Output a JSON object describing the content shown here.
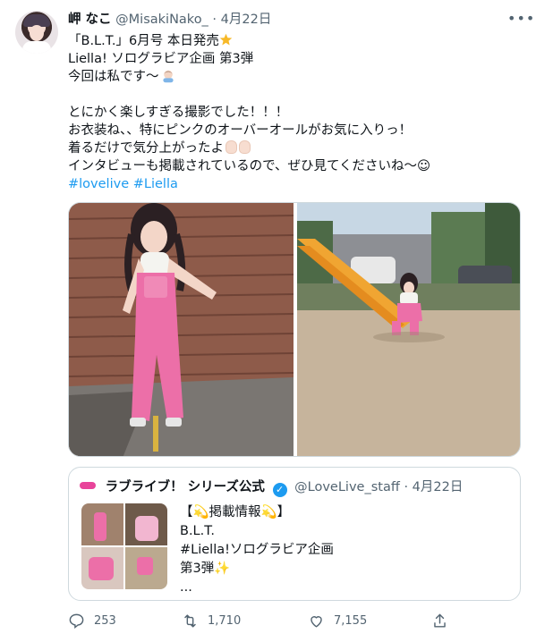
{
  "tweet": {
    "author_name": "岬 なこ",
    "handle": "@MisakiNako_",
    "dot": "·",
    "date": "4月22日",
    "lines": [
      "「B.L.T.」6月号 本日発売",
      "Liella! ソログラビア企画 第3弾",
      "今回は私です〜",
      "",
      "とにかく楽しすぎる撮影でした！！！",
      "お衣装ね、、特にピンクのオーバーオールがお気に入りっ！",
      "着るだけで気分上がったよ",
      "インタビューも掲載されているので、ぜひ見てくださいね〜☺︎"
    ],
    "hashtags": [
      "#lovelive",
      "#Liella"
    ],
    "icons": {
      "more": "more-icon",
      "star_emoji": "star-emoji",
      "person_emoji": "person-emoji",
      "hand_emoji": "ok-hand-emoji"
    }
  },
  "quote": {
    "name": "ラブライブ！ シリーズ公式",
    "handle": "@LoveLive_staff",
    "dot": "·",
    "date": "4月22日",
    "lines": [
      "【💫掲載情報💫】",
      "B.L.T.",
      "#Liella!ソログラビア企画",
      "第3弾✨",
      "..."
    ]
  },
  "actions": {
    "reply_count": "253",
    "retweet_count": "1,710",
    "like_count": "7,155"
  },
  "colors": {
    "link": "#1d9bf0",
    "muted": "#536471",
    "border": "#cfd9de"
  }
}
